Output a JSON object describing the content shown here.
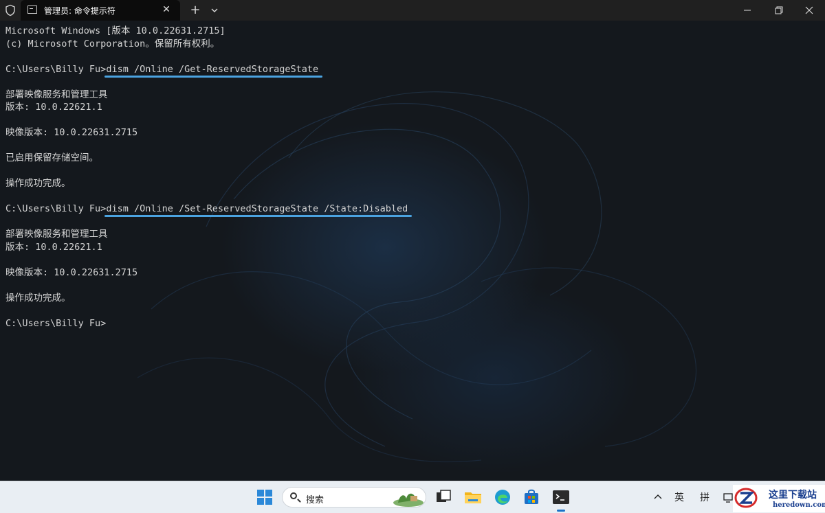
{
  "window": {
    "tab_title": "管理员: 命令提示符",
    "new_tab_glyph": "+",
    "close_glyph": "✕"
  },
  "terminal": {
    "lines": [
      "Microsoft Windows [版本 10.0.22631.2715]",
      "(c) Microsoft Corporation。保留所有权利。",
      "",
      {
        "prompt": "C:\\Users\\Billy Fu>",
        "command": "dism /Online /Get-ReservedStorageState"
      },
      "",
      "部署映像服务和管理工具",
      "版本: 10.0.22621.1",
      "",
      "映像版本: 10.0.22631.2715",
      "",
      "已启用保留存储空间。",
      "",
      "操作成功完成。",
      "",
      {
        "prompt": "C:\\Users\\Billy Fu>",
        "command": "dism /Online /Set-ReservedStorageState /State:Disabled"
      },
      "",
      "部署映像服务和管理工具",
      "版本: 10.0.22621.1",
      "",
      "映像版本: 10.0.22631.2715",
      "",
      "操作成功完成。",
      "",
      "C:\\Users\\Billy Fu>"
    ]
  },
  "taskbar": {
    "search_label": "搜索",
    "tray_lang": "英",
    "tray_ime": "拼",
    "icons": [
      "windows-start-icon",
      "task-view-icon",
      "file-explorer-icon",
      "edge-icon",
      "store-icon",
      "terminal-icon"
    ]
  },
  "watermark": {
    "name": "这里下载站",
    "url": "heredown.com"
  },
  "colors": {
    "accent_underline": "#4ba3e0",
    "terminal_text": "#d4d4d4",
    "titlebar": "#202020",
    "taskbar": "#e9eef3"
  }
}
